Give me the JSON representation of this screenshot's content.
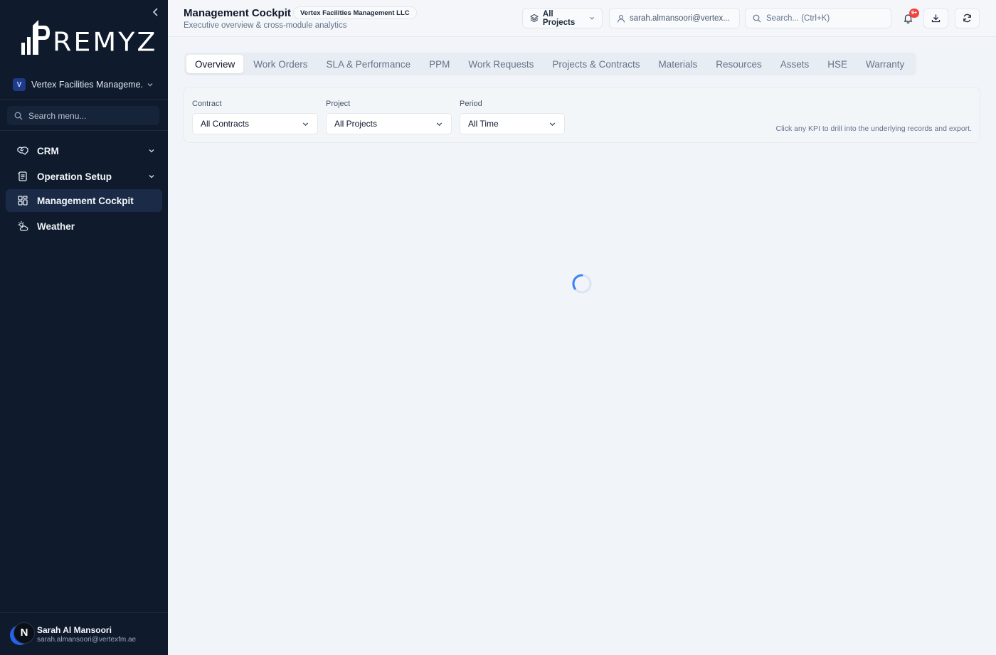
{
  "sidebar": {
    "logo_text": "REMYZ",
    "logo_glyph": "P",
    "org": {
      "badge": "V",
      "name": "Vertex Facilities Manageme..."
    },
    "search_placeholder": "Search menu...",
    "nav": [
      {
        "label": "CRM",
        "icon": "handshake-icon",
        "expandable": true
      },
      {
        "label": "Operation Setup",
        "icon": "clipboard-list-icon",
        "expandable": true
      },
      {
        "label": "Management Cockpit",
        "icon": "dashboard-grid-icon",
        "active": true
      },
      {
        "label": "Weather",
        "icon": "sun-cloud-icon"
      }
    ],
    "user": {
      "initial": "N",
      "name": "Sarah Al Mansoori",
      "email": "sarah.almansoori@vertexfm.ae"
    }
  },
  "header": {
    "title": "Management Cockpit",
    "org_chip": "Vertex Facilities Management LLC",
    "subtitle": "Executive overview & cross-module analytics",
    "project_selector": "All Projects",
    "user_email": "sarah.almansoori@vertex...",
    "search_placeholder": "Search... (Ctrl+K)",
    "notification_badge": "9+"
  },
  "tabs": [
    {
      "label": "Overview",
      "active": true
    },
    {
      "label": "Work Orders"
    },
    {
      "label": "SLA & Performance"
    },
    {
      "label": "PPM"
    },
    {
      "label": "Work Requests"
    },
    {
      "label": "Projects & Contracts"
    },
    {
      "label": "Materials"
    },
    {
      "label": "Resources"
    },
    {
      "label": "Assets"
    },
    {
      "label": "HSE"
    },
    {
      "label": "Warranty"
    }
  ],
  "filters": {
    "contract": {
      "label": "Contract",
      "value": "All Contracts"
    },
    "project": {
      "label": "Project",
      "value": "All Projects"
    },
    "period": {
      "label": "Period",
      "value": "All Time"
    },
    "hint": "Click any KPI to drill into the underlying records and export."
  },
  "colors": {
    "sidebar_bg": "#0f1b2d",
    "active_nav_bg": "#1b2a46",
    "accent": "#2563eb",
    "badge": "#ef4444",
    "page_bg": "#f1f4f8"
  }
}
